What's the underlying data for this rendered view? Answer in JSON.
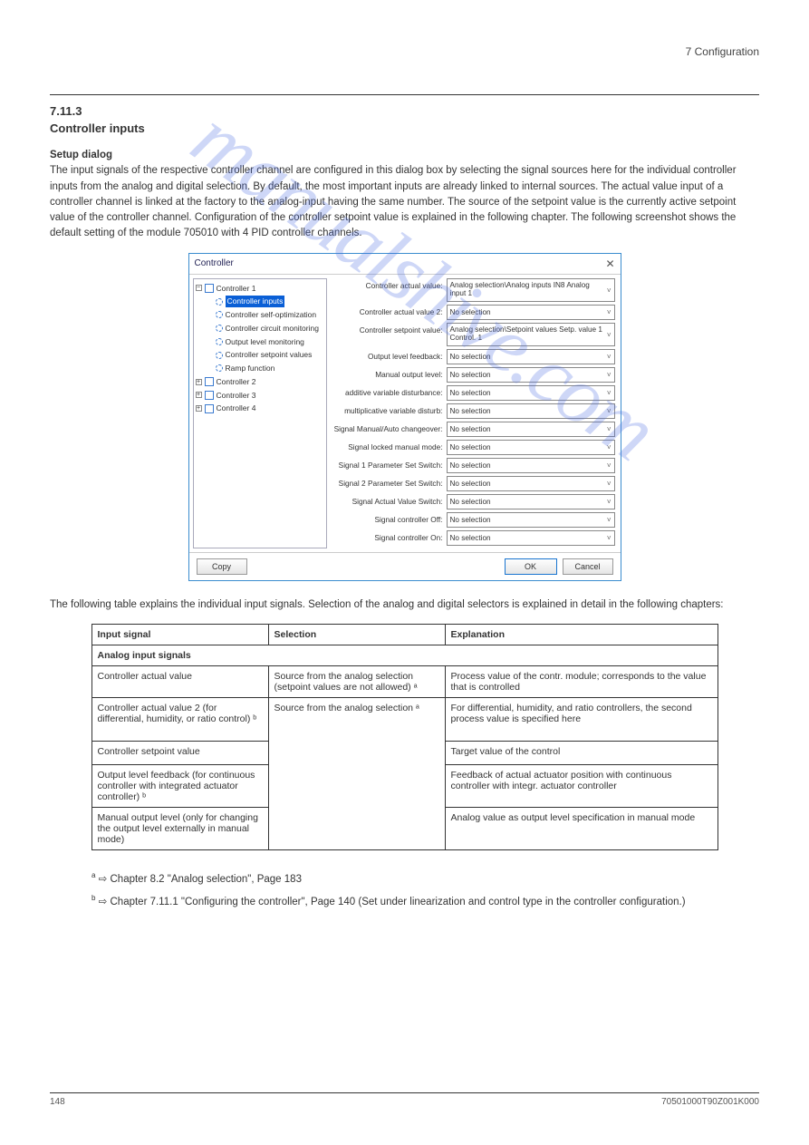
{
  "watermark": "manualshive.com",
  "header": {
    "label": "7 Configuration"
  },
  "section": {
    "number": "7.11.3",
    "title": "Controller inputs",
    "p1_bold": "Setup dialog",
    "p1_rest": "The input signals of the respective controller channel are configured in this dialog box by selecting the signal sources here for the individual controller inputs from the analog and digital selection. By default, the most important inputs are already linked to internal sources. The actual value input of a controller channel is linked at the factory to the analog-input having the same number. The source of the setpoint value is the currently active setpoint value of the controller channel. Configuration of the controller setpoint value is explained in the following chapter. The following screenshot shows the default setting of the module 705010 with 4 PID controller channels.",
    "p2": "The following table explains the individual input signals. Selection of the analog and digital selectors is explained in detail in the following chapters:"
  },
  "dialog": {
    "title": "Controller",
    "tree": [
      "Controller 1",
      "Controller inputs",
      "Controller self-optimization",
      "Controller circuit monitoring",
      "Output level monitoring",
      "Controller setpoint values",
      "Ramp function",
      "Controller 2",
      "Controller 3",
      "Controller 4"
    ],
    "rows": [
      {
        "label": "Controller actual value:",
        "value": "Analog selection\\Analog inputs IN8 Analog input 1"
      },
      {
        "label": "Controller actual value 2:",
        "value": "No selection"
      },
      {
        "label": "Controller setpoint value:",
        "value": "Analog selection\\Setpoint values Setp. value 1 Control. 1"
      },
      {
        "label": "Output level feedback:",
        "value": "No selection"
      },
      {
        "label": "Manual output level:",
        "value": "No selection"
      },
      {
        "label": "additive variable disturbance:",
        "value": "No selection"
      },
      {
        "label": "multiplicative variable disturb:",
        "value": "No selection"
      },
      {
        "label": "Signal Manual/Auto changeover:",
        "value": "No selection"
      },
      {
        "label": "Signal locked manual mode:",
        "value": "No selection"
      },
      {
        "label": "Signal 1 Parameter Set Switch:",
        "value": "No selection"
      },
      {
        "label": "Signal 2 Parameter Set Switch:",
        "value": "No selection"
      },
      {
        "label": "Signal Actual Value Switch:",
        "value": "No selection"
      },
      {
        "label": "Signal controller Off:",
        "value": "No selection"
      },
      {
        "label": "Signal controller On:",
        "value": "No selection"
      }
    ],
    "buttons": {
      "copy": "Copy",
      "ok": "OK",
      "cancel": "Cancel"
    }
  },
  "table": {
    "headers": [
      "Input signal",
      "Selection",
      "Explanation"
    ],
    "subhead": "Analog input signals",
    "rows": [
      [
        "Controller actual value",
        "Source from the analog selection (setpoint values are not allowed) ᵃ",
        "Process value of the contr. module; corresponds to the value that is controlled"
      ],
      [
        "Controller actual value 2 (for differential, humidity, or ratio control) ᵇ",
        "Source from the analog selection ᵃ",
        "For differential, humidity, and ratio controllers, the second process value is specified here"
      ],
      [
        "Controller setpoint value",
        "",
        "Target value of the control"
      ],
      [
        "Output level feedback (for continuous controller with integrated actuator controller) ᵇ",
        "",
        "Feedback of actual actuator position with continuous controller with integr. actuator controller"
      ],
      [
        "Manual output level (only for changing the output level externally in manual mode)",
        "",
        "Analog value as output level specification in manual mode"
      ]
    ]
  },
  "notes": {
    "a_sup": "a",
    "a_text": "⇨ Chapter 8.2 \"Analog selection\", Page 183",
    "b_sup": "b",
    "b_text": "⇨ Chapter 7.11.1 \"Configuring the controller\", Page 140 (Set under linearization and control type in the controller configuration.)"
  },
  "footer": {
    "page": "148",
    "docid": "70501000T90Z001K000"
  }
}
